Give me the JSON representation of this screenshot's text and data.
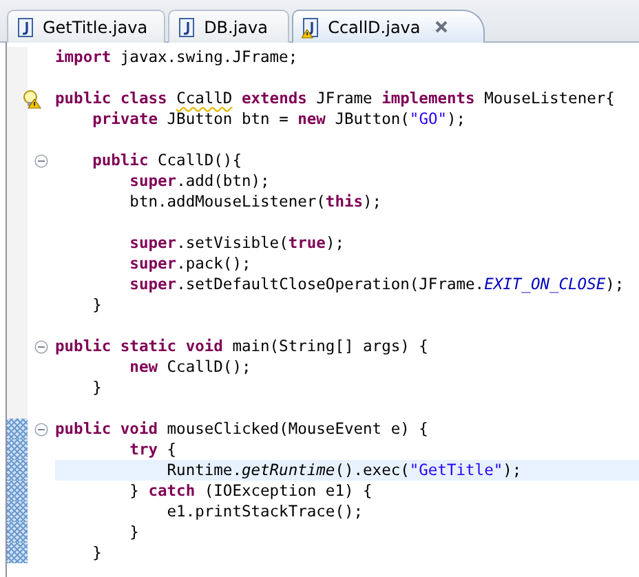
{
  "tabs": [
    {
      "label": "GetTitle.java",
      "selected": false
    },
    {
      "label": "DB.java",
      "selected": false
    },
    {
      "label": "CcallD.java",
      "selected": true,
      "warning": true,
      "closable": true
    }
  ],
  "editor": {
    "lines": [
      {
        "kind": "code",
        "segments": [
          {
            "kind": "keyword",
            "text": "import"
          },
          {
            "kind": "plain",
            "text": " javax.swing.JFrame;"
          }
        ]
      },
      {
        "kind": "blank"
      },
      {
        "kind": "code",
        "warning": true,
        "segments": [
          {
            "kind": "keyword",
            "text": "public class "
          },
          {
            "kind": "warning",
            "text": "CcallD"
          },
          {
            "kind": "keyword",
            "text": " extends"
          },
          {
            "kind": "plain",
            "text": " JFrame "
          },
          {
            "kind": "keyword",
            "text": "implements"
          },
          {
            "kind": "plain",
            "text": " MouseListener{"
          }
        ]
      },
      {
        "kind": "code",
        "segments": [
          {
            "kind": "keyword",
            "text": "    private"
          },
          {
            "kind": "plain",
            "text": " JButton btn = "
          },
          {
            "kind": "keyword",
            "text": "new"
          },
          {
            "kind": "plain",
            "text": " JButton("
          },
          {
            "kind": "string",
            "text": "\"GO\""
          },
          {
            "kind": "plain",
            "text": ");"
          }
        ]
      },
      {
        "kind": "blank"
      },
      {
        "kind": "code",
        "expanded": true,
        "segments": [
          {
            "kind": "keyword",
            "text": "    public"
          },
          {
            "kind": "plain",
            "text": " CcallD(){"
          }
        ]
      },
      {
        "kind": "code",
        "segments": [
          {
            "kind": "keyword",
            "text": "        super"
          },
          {
            "kind": "plain",
            "text": ".add(btn);"
          }
        ]
      },
      {
        "kind": "code",
        "segments": [
          {
            "kind": "plain",
            "text": "        btn.addMouseListener("
          },
          {
            "kind": "keyword",
            "text": "this"
          },
          {
            "kind": "plain",
            "text": ");"
          }
        ]
      },
      {
        "kind": "blank"
      },
      {
        "kind": "code",
        "segments": [
          {
            "kind": "keyword",
            "text": "        super"
          },
          {
            "kind": "plain",
            "text": ".setVisible("
          },
          {
            "kind": "keyword",
            "text": "true"
          },
          {
            "kind": "plain",
            "text": ");"
          }
        ]
      },
      {
        "kind": "code",
        "segments": [
          {
            "kind": "keyword",
            "text": "        super"
          },
          {
            "kind": "plain",
            "text": ".pack();"
          }
        ]
      },
      {
        "kind": "code",
        "segments": [
          {
            "kind": "keyword",
            "text": "        super"
          },
          {
            "kind": "plain",
            "text": ".setDefaultCloseOperation(JFrame."
          },
          {
            "kind": "constant",
            "text": "EXIT_ON_CLOSE"
          },
          {
            "kind": "plain",
            "text": ");"
          }
        ]
      },
      {
        "kind": "code",
        "segments": [
          {
            "kind": "plain",
            "text": "    }"
          }
        ]
      },
      {
        "kind": "blank"
      },
      {
        "kind": "code",
        "expanded": true,
        "segments": [
          {
            "kind": "keyword",
            "text": "public static void"
          },
          {
            "kind": "plain",
            "text": " main(String[] args) {"
          }
        ]
      },
      {
        "kind": "code",
        "segments": [
          {
            "kind": "keyword",
            "text": "        new"
          },
          {
            "kind": "plain",
            "text": " CcallD();"
          }
        ]
      },
      {
        "kind": "code",
        "segments": [
          {
            "kind": "plain",
            "text": "    }"
          }
        ]
      },
      {
        "kind": "blank"
      },
      {
        "kind": "code",
        "expanded": true,
        "range": true,
        "segments": [
          {
            "kind": "keyword",
            "text": "public void"
          },
          {
            "kind": "plain",
            "text": " mouseClicked(MouseEvent e) {"
          }
        ]
      },
      {
        "kind": "code",
        "range": true,
        "segments": [
          {
            "kind": "keyword",
            "text": "        try"
          },
          {
            "kind": "plain",
            "text": " {"
          }
        ]
      },
      {
        "kind": "code",
        "range": true,
        "current": true,
        "segments": [
          {
            "kind": "plain",
            "text": "            Runtime."
          },
          {
            "kind": "static",
            "text": "getRuntime"
          },
          {
            "kind": "plain",
            "text": "().exec("
          },
          {
            "kind": "string",
            "text": "\"GetTitle\""
          },
          {
            "kind": "plain",
            "text": ");"
          }
        ]
      },
      {
        "kind": "code",
        "range": true,
        "segments": [
          {
            "kind": "plain",
            "text": "        } "
          },
          {
            "kind": "keyword",
            "text": "catch"
          },
          {
            "kind": "plain",
            "text": " (IOException e1) {"
          }
        ]
      },
      {
        "kind": "code",
        "range": true,
        "segments": [
          {
            "kind": "plain",
            "text": "            e1.printStackTrace();"
          }
        ]
      },
      {
        "kind": "code",
        "range": true,
        "segments": [
          {
            "kind": "plain",
            "text": "        }"
          }
        ]
      },
      {
        "kind": "code",
        "range": true,
        "segments": [
          {
            "kind": "plain",
            "text": "    }"
          }
        ]
      }
    ]
  }
}
